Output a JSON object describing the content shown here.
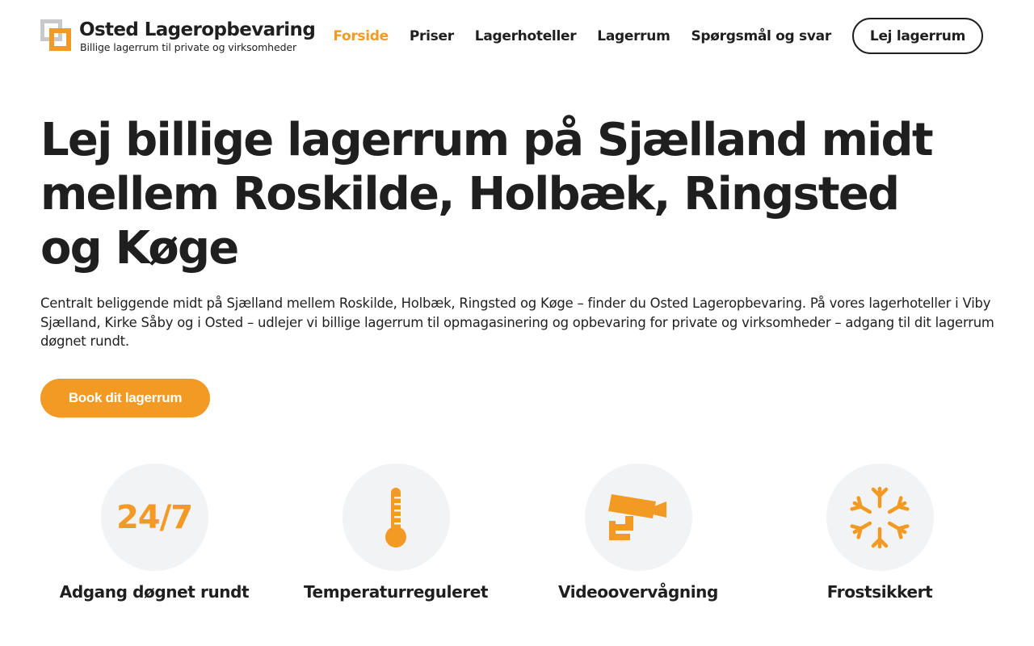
{
  "brand": {
    "name": "Osted Lageropbevaring",
    "tagline": "Billige lagerrum til private og virksomheder",
    "colors": {
      "accent": "#f39a24",
      "text": "#1f1f1f",
      "logo_gray": "#c9c9cc",
      "icon_bg": "#f2f3f4"
    }
  },
  "nav": {
    "items": [
      {
        "label": "Forside",
        "active": true
      },
      {
        "label": "Priser",
        "active": false
      },
      {
        "label": "Lagerhoteller",
        "active": false
      },
      {
        "label": "Lagerrum",
        "active": false
      },
      {
        "label": "Spørgsmål og svar",
        "active": false
      }
    ],
    "cta_label": "Lej lagerrum"
  },
  "hero": {
    "title": "Lej billige lagerrum på Sjælland midt mellem Roskilde, Holbæk, Ringsted og Køge",
    "text": "Centralt beliggende midt på Sjælland mellem Roskilde, Holbæk, Ringsted og Køge – finder du Osted Lageropbevaring. På vores lagerhoteller i Viby Sjælland, Kirke Såby og i Osted – udlejer vi billige lagerrum til opmagasinering og opbevaring for private og virksomheder – adgang til dit lagerrum døgnet rundt.",
    "button_label": "Book dit lagerrum"
  },
  "features": [
    {
      "icon": "clock-24-7-icon",
      "icon_text": "24/7",
      "label": "Adgang døgnet rundt"
    },
    {
      "icon": "thermometer-icon",
      "label": "Temperaturreguleret"
    },
    {
      "icon": "security-camera-icon",
      "label": "Videoovervågning"
    },
    {
      "icon": "snowflake-icon",
      "label": "Frostsikkert"
    }
  ]
}
